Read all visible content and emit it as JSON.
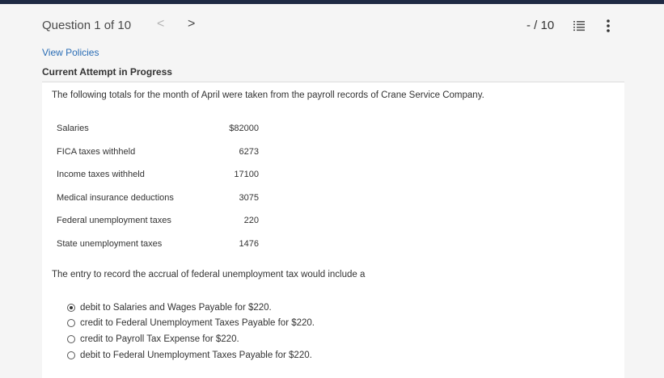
{
  "header": {
    "question_label": "Question 1 of 10",
    "prev_glyph": "<",
    "next_glyph": ">",
    "score": "- / 10",
    "list_icon": "list-icon",
    "more_icon": "more-vertical-icon"
  },
  "links": {
    "view_policies": "View Policies"
  },
  "status": {
    "attempt": "Current Attempt in Progress"
  },
  "problem": {
    "intro": "The following totals for the month of April were taken from the payroll records of Crane Service Company.",
    "rows": [
      {
        "label": "Salaries",
        "value": "$82000"
      },
      {
        "label": "FICA taxes withheld",
        "value": "6273"
      },
      {
        "label": "Income taxes withheld",
        "value": "17100"
      },
      {
        "label": "Medical insurance deductions",
        "value": "3075"
      },
      {
        "label": "Federal unemployment taxes",
        "value": "220"
      },
      {
        "label": "State unemployment taxes",
        "value": "1476"
      }
    ],
    "question": "The entry to record the accrual of federal unemployment tax would include a",
    "options": [
      {
        "text": "debit to Salaries and Wages Payable for $220.",
        "selected": true
      },
      {
        "text": "credit to Federal Unemployment Taxes Payable for $220.",
        "selected": false
      },
      {
        "text": "credit to Payroll Tax Expense for $220.",
        "selected": false
      },
      {
        "text": "debit to Federal Unemployment Taxes Payable for $220.",
        "selected": false
      }
    ]
  },
  "colors": {
    "top_bar": "#1f2a44",
    "link": "#2a6db5",
    "background": "#f5f5f5"
  }
}
